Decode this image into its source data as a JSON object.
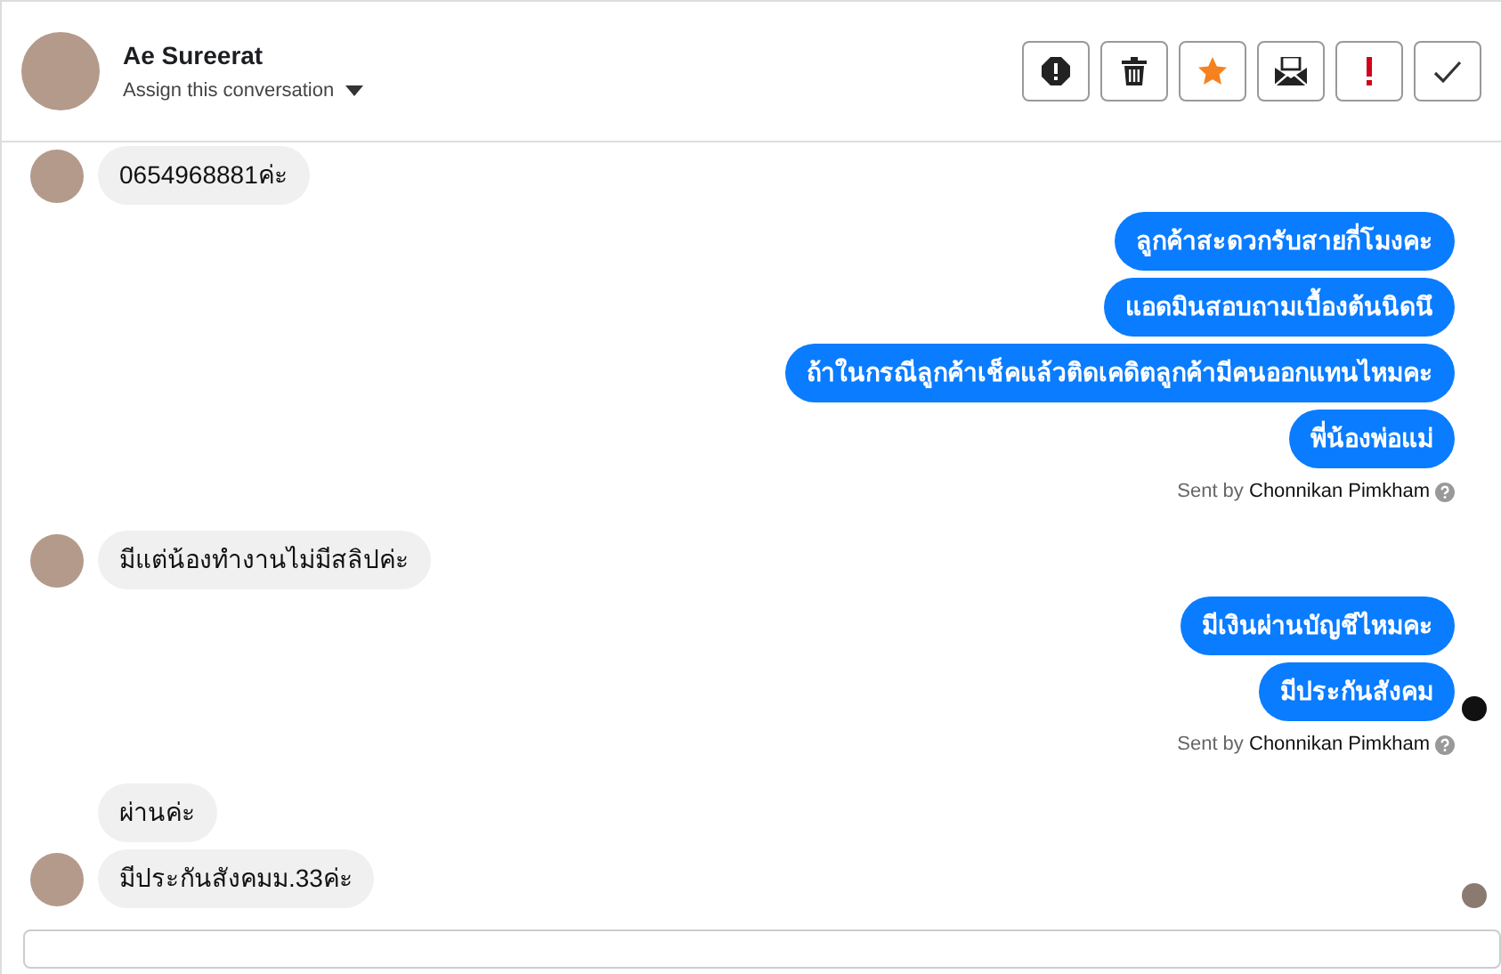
{
  "header": {
    "name": "Ae Sureerat",
    "assign": "Assign this conversation",
    "actions": [
      {
        "kind": "alert"
      },
      {
        "kind": "trash"
      },
      {
        "kind": "star"
      },
      {
        "kind": "mail"
      },
      {
        "kind": "exclaim"
      },
      {
        "kind": "check"
      }
    ]
  },
  "messages": [
    {
      "kind": "incoming",
      "avatar": true,
      "text": "0654968881ค่ะ"
    },
    {
      "kind": "outgoing",
      "text": "ลูกค้าสะดวกรับสายกี่โมงคะ"
    },
    {
      "kind": "outgoing",
      "text": "แอดมินสอบถามเบื้องต้นนิดนึ"
    },
    {
      "kind": "outgoing",
      "text": "ถ้าในกรณีลูกค้าเช็คแล้วติดเคดิตลูกค้ามีคนออกแทนไหมคะ"
    },
    {
      "kind": "outgoing",
      "text": "พี่น้องพ่อแม่"
    },
    {
      "kind": "sent_by",
      "prefix": "Sent by",
      "agent": "Chonnikan Pimkham"
    },
    {
      "kind": "incoming",
      "avatar": true,
      "text": "มีแต่น้องทำงานไม่มีสลิปค่ะ"
    },
    {
      "kind": "outgoing",
      "text": "มีเงินผ่านบัญชีไหมคะ"
    },
    {
      "kind": "outgoing",
      "receipt": {
        "kind": "logo"
      },
      "text": "มีประกันสังคม"
    },
    {
      "kind": "sent_by",
      "prefix": "Sent by",
      "agent": "Chonnikan Pimkham"
    },
    {
      "kind": "incoming",
      "avatar": false,
      "text": "ผ่านค่ะ"
    },
    {
      "kind": "incoming",
      "avatar": true,
      "receipt": {
        "kind": "avatar"
      },
      "text": "มีประกันสังคมม.33ค่ะ"
    }
  ]
}
